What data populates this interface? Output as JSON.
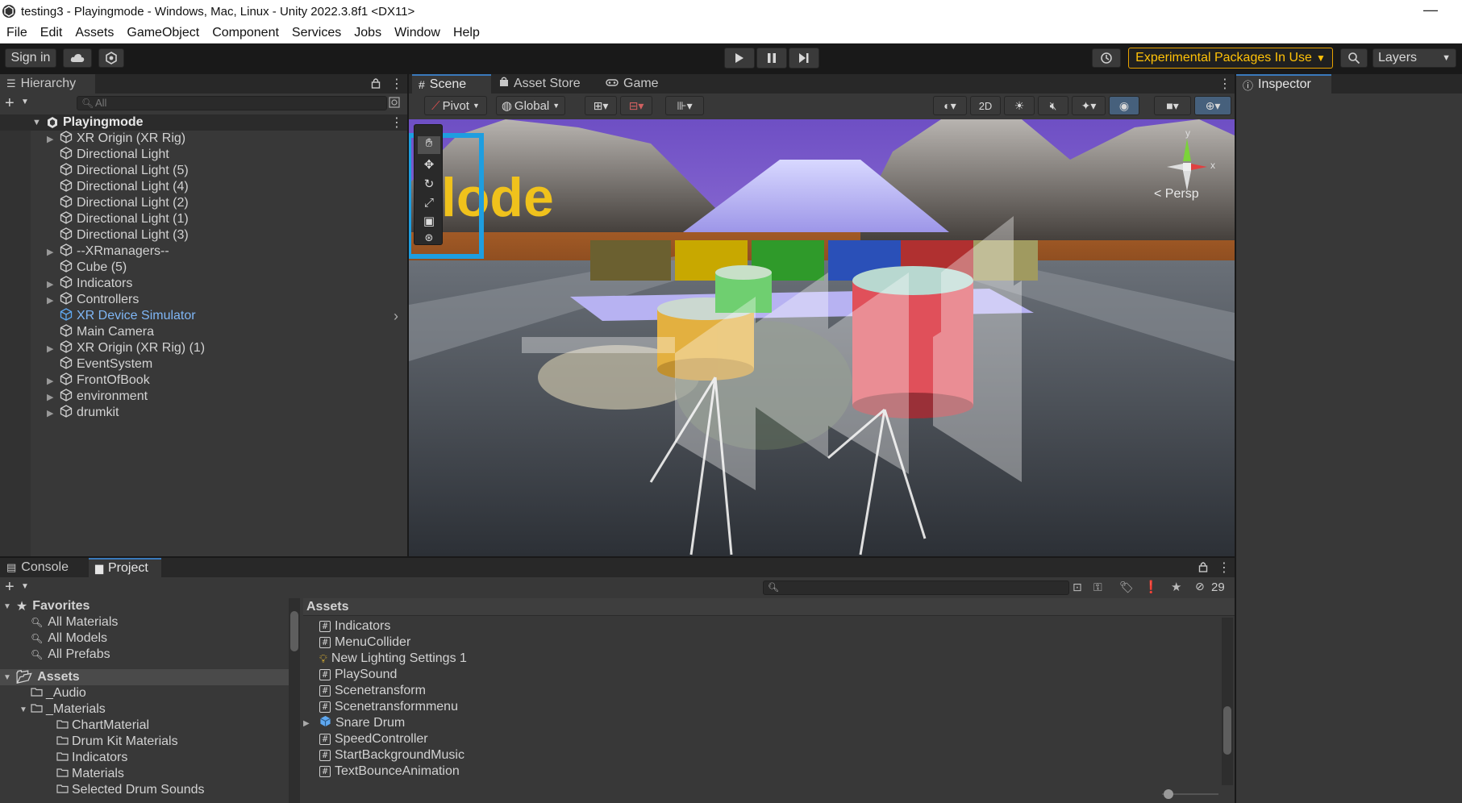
{
  "window": {
    "title": "testing3 - Playingmode - Windows, Mac, Linux - Unity 2022.3.8f1 <DX11>",
    "minimize": "—"
  },
  "menu": [
    "File",
    "Edit",
    "Assets",
    "GameObject",
    "Component",
    "Services",
    "Jobs",
    "Window",
    "Help"
  ],
  "toolbar": {
    "sign_in": "Sign in",
    "experimental": "Experimental Packages In Use",
    "layers": "Layers"
  },
  "hierarchy": {
    "tab": "Hierarchy",
    "search_placeholder": "All",
    "scene": "Playingmode",
    "items": [
      {
        "label": "XR Origin (XR Rig)",
        "expandable": true
      },
      {
        "label": "Directional Light",
        "expandable": false
      },
      {
        "label": "Directional Light (5)",
        "expandable": false
      },
      {
        "label": "Directional Light (4)",
        "expandable": false
      },
      {
        "label": "Directional Light (2)",
        "expandable": false
      },
      {
        "label": "Directional Light (1)",
        "expandable": false
      },
      {
        "label": "Directional Light (3)",
        "expandable": false
      },
      {
        "label": "--XRmanagers--",
        "expandable": true
      },
      {
        "label": "Cube (5)",
        "expandable": false
      },
      {
        "label": "Indicators",
        "expandable": true
      },
      {
        "label": "Controllers",
        "expandable": true
      },
      {
        "label": "XR Device Simulator",
        "expandable": false
      },
      {
        "label": "Main Camera",
        "expandable": false
      },
      {
        "label": "XR Origin (XR Rig) (1)",
        "expandable": true
      },
      {
        "label": "EventSystem",
        "expandable": false
      },
      {
        "label": "FrontOfBook",
        "expandable": true
      },
      {
        "label": "environment",
        "expandable": true
      },
      {
        "label": "drumkit",
        "expandable": true
      }
    ]
  },
  "scene": {
    "tabs": [
      "Scene",
      "Asset Store",
      "Game"
    ],
    "pivot": "Pivot",
    "global": "Global",
    "mode_2d": "2D",
    "persp": "< Persp",
    "gizmo_y": "y",
    "gizmo_x": "x",
    "sign_text": "lode"
  },
  "inspector": {
    "tab": "Inspector"
  },
  "bottom": {
    "tabs": [
      "Console",
      "Project"
    ],
    "hidden_count": "29",
    "favorites_header": "Favorites",
    "favorites": [
      "All Materials",
      "All Models",
      "All Prefabs"
    ],
    "assets_header": "Assets",
    "asset_tree": [
      {
        "label": "_Audio",
        "indent": 1,
        "expanded": false
      },
      {
        "label": "_Materials",
        "indent": 1,
        "expanded": true
      },
      {
        "label": "ChartMaterial",
        "indent": 2,
        "expanded": false
      },
      {
        "label": "Drum Kit Materials",
        "indent": 2,
        "expanded": false
      },
      {
        "label": "Indicators",
        "indent": 2,
        "expanded": false
      },
      {
        "label": "Materials",
        "indent": 2,
        "expanded": false
      },
      {
        "label": "Selected Drum Sounds",
        "indent": 2,
        "expanded": false
      }
    ],
    "breadcrumb": "Assets",
    "files": [
      {
        "label": "Indicators",
        "icon": "script"
      },
      {
        "label": "MenuCollider",
        "icon": "script"
      },
      {
        "label": "New Lighting Settings 1",
        "icon": "lighting"
      },
      {
        "label": "PlaySound",
        "icon": "script"
      },
      {
        "label": "Scenetransform",
        "icon": "script"
      },
      {
        "label": "Scenetransformmenu",
        "icon": "script"
      },
      {
        "label": "Snare Drum",
        "icon": "prefab"
      },
      {
        "label": "SpeedController",
        "icon": "script"
      },
      {
        "label": "StartBackgroundMusic",
        "icon": "script"
      },
      {
        "label": "TextBounceAnimation",
        "icon": "script"
      }
    ]
  },
  "colors": {
    "accent": "#3a79bb",
    "warning": "#ffc107",
    "selected_text": "#7fb6f5"
  }
}
